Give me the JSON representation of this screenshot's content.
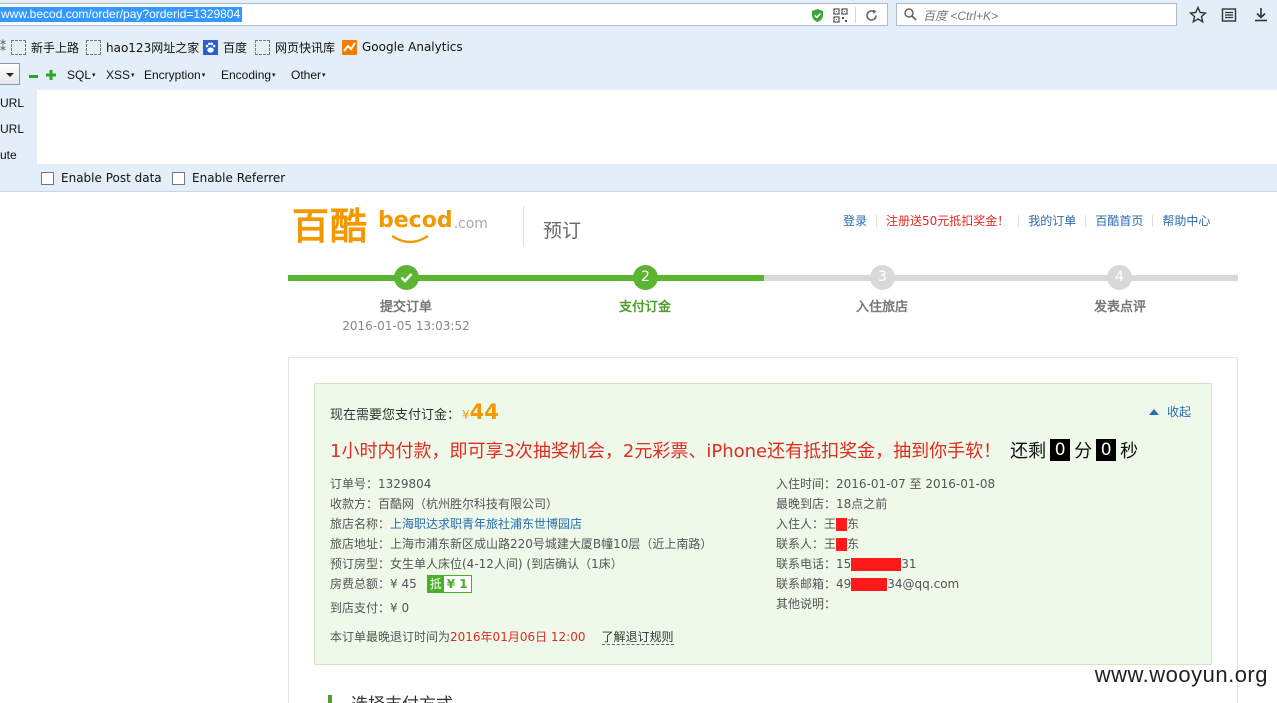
{
  "browser": {
    "url": "www.becod.com/order/pay?orderid=1329804",
    "search_placeholder": "百度 <Ctrl+K>"
  },
  "bookmarks": [
    {
      "label": "新手上路",
      "icon": "page-dashed-icon"
    },
    {
      "label": "hao123网址之家",
      "icon": "page-dashed-icon"
    },
    {
      "label": "百度",
      "icon": "baidu-paw-icon"
    },
    {
      "label": "网页快讯库",
      "icon": "page-dashed-icon"
    },
    {
      "label": "Google Analytics",
      "icon": "analytics-icon"
    }
  ],
  "hackbar": {
    "menus": [
      "SQL",
      "XSS",
      "Encryption",
      "Encoding",
      "Other"
    ],
    "side_labels": [
      "URL",
      "URL",
      "ute"
    ],
    "options": [
      "Enable Post data",
      "Enable Referrer"
    ]
  },
  "site": {
    "logo_cn": "百酷",
    "logo_en": "becod",
    "logo_com": ".com",
    "section": "预订",
    "nav": [
      {
        "label": "登录",
        "highlight": false
      },
      {
        "label": "注册送50元抵扣奖金！",
        "highlight": true
      },
      {
        "label": "我的订单",
        "highlight": false
      },
      {
        "label": "百酷首页",
        "highlight": false
      },
      {
        "label": "帮助中心",
        "highlight": false
      }
    ]
  },
  "steps": [
    {
      "num": "✓",
      "label": "提交订单",
      "done": true
    },
    {
      "num": "2",
      "label": "支付订金",
      "done": true
    },
    {
      "num": "3",
      "label": "入住旅店",
      "done": false
    },
    {
      "num": "4",
      "label": "发表点评",
      "done": false
    }
  ],
  "step1_time": "2016-01-05 13:03:52",
  "order": {
    "pay_label": "现在需要您支付订金：",
    "currency": "¥",
    "amount": "44",
    "collapse": "收起",
    "promo": "1小时内付款，即可享3次抽奖机会，2元彩票、iPhone还有抵扣奖金，抽到你手软！",
    "remain": "还剩",
    "minutes": "0",
    "minute_unit": "分",
    "seconds": "0",
    "second_unit": "秒",
    "left": {
      "order_no": "订单号：1329804",
      "payee": "收款方：百酷网（杭州胜尔科技有限公司）",
      "hotel_label": "旅店名称：",
      "hotel_name": "上海职达求职青年旅社浦东世博园店",
      "address": "旅店地址：上海市浦东新区成山路220号城建大厦B幢10层（近上南路）",
      "room": "预订房型：女生单人床位(4-12人间) (到店确认（1床）",
      "total": "房费总额：¥ 45",
      "deduct_tag": "抵",
      "deduct_val": "¥ 1",
      "pay_at_hotel": "到店支付：¥ 0"
    },
    "right": {
      "checkin": "入住时间：2016-01-07 至 2016-01-08",
      "latest": "最晚到店：18点之前",
      "guest_label": "入住人：王",
      "guest_tail": "东",
      "contact_label": "联系人：王",
      "contact_tail": "东",
      "phone_label": "联系电话：15",
      "phone_tail": "31",
      "email_label": "联系邮箱：49",
      "email_tail": "34@qq.com",
      "notes": "其他说明："
    },
    "cancel_prefix": "本订单最晚退订时间为",
    "cancel_time": "2016年01月06日 12:00",
    "cancel_rule": "了解退订规则"
  },
  "next_section": "选择支付方式",
  "watermark": "www.wooyun.org",
  "colors": {
    "brand": "#f39800",
    "step_done": "#5cb531",
    "step_todo": "#d9d9d9",
    "link": "#2b6bb0",
    "alert": "#e02b20"
  }
}
